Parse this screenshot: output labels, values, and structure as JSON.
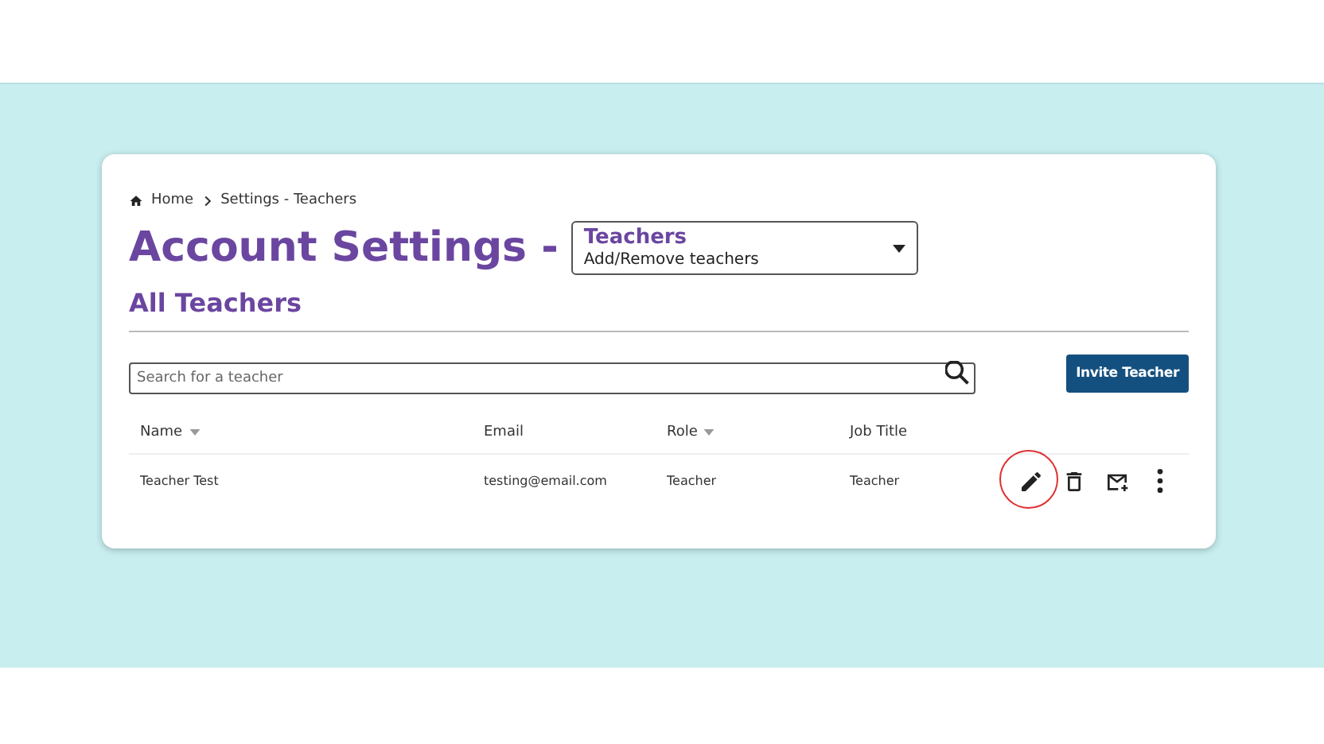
{
  "breadcrumb": [
    "Home",
    "Settings - Teachers"
  ],
  "title": "Account Settings -",
  "section_select": {
    "value": "Teachers",
    "description": "Add/Remove teachers"
  },
  "subtitle": "All Teachers",
  "search": {
    "placeholder": "Search for a teacher"
  },
  "invite_button": "Invite Teacher",
  "table": {
    "columns": [
      {
        "label": "Name",
        "sortable": true
      },
      {
        "label": "Email",
        "sortable": false
      },
      {
        "label": "Role",
        "sortable": true
      },
      {
        "label": "Job Title",
        "sortable": false
      }
    ],
    "rows": [
      {
        "cells": [
          "Teacher Test",
          "testing@email.com",
          "Teacher",
          "Teacher"
        ],
        "actions": [
          {
            "kind": "edit",
            "highlighted": true
          },
          {
            "kind": "delete",
            "highlighted": false
          },
          {
            "kind": "mail",
            "highlighted": false
          },
          {
            "kind": "more",
            "highlighted": false
          }
        ]
      }
    ]
  }
}
